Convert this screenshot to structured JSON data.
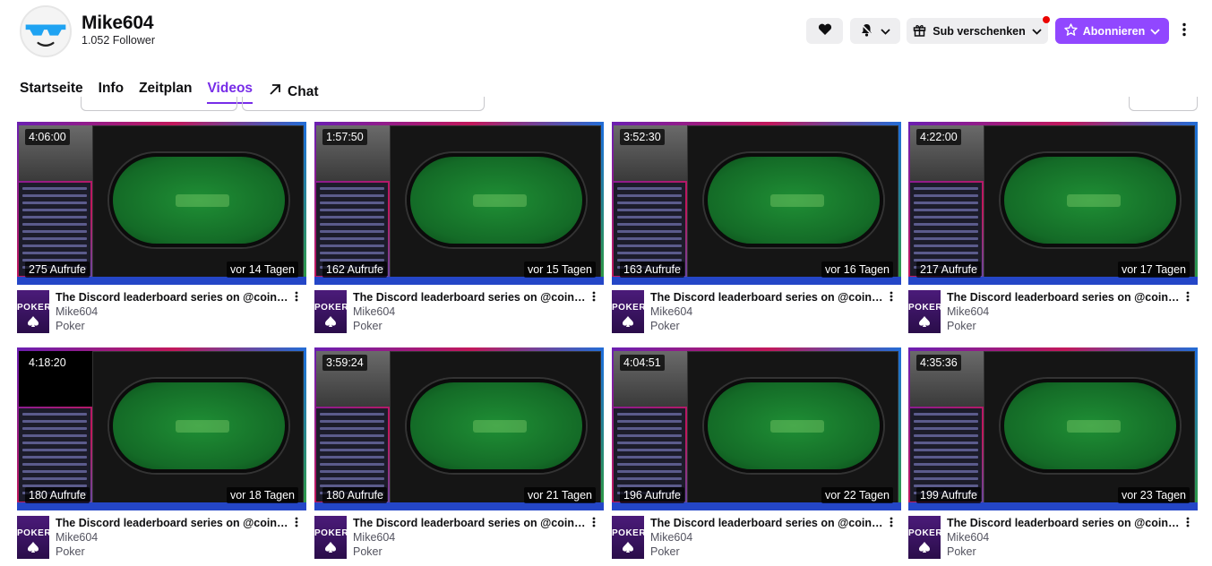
{
  "channel": {
    "name": "Mike604",
    "followers": "1.052 Follower"
  },
  "header_actions": {
    "gift_label": "Sub verschenken",
    "subscribe_label": "Abonnieren"
  },
  "tabs": [
    {
      "label": "Startseite"
    },
    {
      "label": "Info"
    },
    {
      "label": "Zeitplan"
    },
    {
      "label": "Videos"
    },
    {
      "label": "Chat"
    }
  ],
  "colors": {
    "accent": "#9147ff",
    "active_tab": "#772ce8"
  },
  "videos": [
    {
      "duration": "4:06:00",
      "views": "275 Aufrufe",
      "age": "vor 14 Tagen",
      "title": "The Discord leaderboard series on @coinp...",
      "channel": "Mike604",
      "category": "Poker"
    },
    {
      "duration": "1:57:50",
      "views": "162 Aufrufe",
      "age": "vor 15 Tagen",
      "title": "The Discord leaderboard series on @coinp...",
      "channel": "Mike604",
      "category": "Poker"
    },
    {
      "duration": "3:52:30",
      "views": "163 Aufrufe",
      "age": "vor 16 Tagen",
      "title": "The Discord leaderboard series on @coinp...",
      "channel": "Mike604",
      "category": "Poker"
    },
    {
      "duration": "4:22:00",
      "views": "217 Aufrufe",
      "age": "vor 17 Tagen",
      "title": "The Discord leaderboard series on @coinp...",
      "channel": "Mike604",
      "category": "Poker"
    },
    {
      "duration": "4:18:20",
      "views": "180 Aufrufe",
      "age": "vor 18 Tagen",
      "title": "The Discord leaderboard series on @coinp...",
      "channel": "Mike604",
      "category": "Poker"
    },
    {
      "duration": "3:59:24",
      "views": "180 Aufrufe",
      "age": "vor 21 Tagen",
      "title": "The Discord leaderboard series on @coinp...",
      "channel": "Mike604",
      "category": "Poker"
    },
    {
      "duration": "4:04:51",
      "views": "196 Aufrufe",
      "age": "vor 22 Tagen",
      "title": "The Discord leaderboard series on @coinp...",
      "channel": "Mike604",
      "category": "Poker"
    },
    {
      "duration": "4:35:36",
      "views": "199 Aufrufe",
      "age": "vor 23 Tagen",
      "title": "The Discord leaderboard series on @coinp...",
      "channel": "Mike604",
      "category": "Poker"
    }
  ],
  "game_art_label": "POKER",
  "icons": {
    "heart": "heart-icon",
    "bell": "bell-icon",
    "gift": "gift-icon",
    "star": "star-icon",
    "external": "external-link-icon",
    "more": "more-vertical-icon"
  }
}
